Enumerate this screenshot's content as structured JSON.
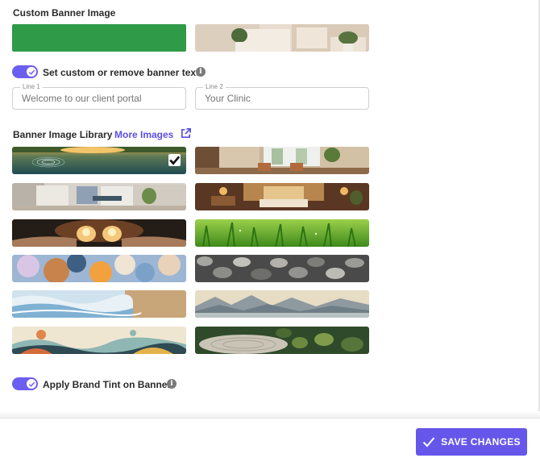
{
  "custom_banner": {
    "title": "Custom Banner Image",
    "color_swatch": "#2f9a47",
    "image_name": "spa-interior-thumbnail"
  },
  "banner_text": {
    "toggle_label": "Set custom or remove banner text",
    "toggle_on": true,
    "line1": {
      "label": "Line 1",
      "placeholder": "Welcome to our client portal"
    },
    "line2": {
      "label": "Line 2",
      "placeholder": "Your Clinic"
    }
  },
  "library": {
    "title": "Banner Image Library",
    "more_link": "More Images",
    "selected_index": 0,
    "images": [
      "lake-ripples",
      "modern-lounge",
      "treatment-room",
      "warm-bedroom",
      "candle-hands",
      "green-grass",
      "bokeh-lights",
      "river-pebbles",
      "ocean-wave",
      "misty-mountains",
      "abstract-landscape",
      "zen-garden"
    ]
  },
  "brand_tint": {
    "label": "Apply Brand Tint on Banner",
    "toggle_on": true
  },
  "footer": {
    "save_label": "SAVE CHANGES"
  },
  "colors": {
    "accent": "#6656ea",
    "toggle": "#6b5ff0",
    "link": "#5b4fe0"
  }
}
